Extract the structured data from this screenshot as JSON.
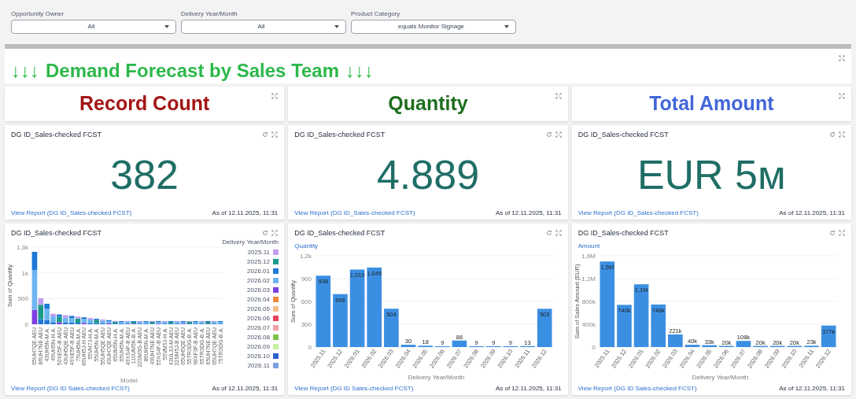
{
  "filters": [
    {
      "label": "Opportunity Owner",
      "value": "All"
    },
    {
      "label": "Delivery Year/Month",
      "value": "All"
    },
    {
      "label": "Product Category",
      "value": "equals Monitor Signage"
    }
  ],
  "banner": {
    "arrows_left": "↓↓↓",
    "title": "Demand Forecast by Sales Team",
    "arrows_right": "↓↓↓"
  },
  "headers": [
    {
      "title": "Record Count",
      "color": "#a31515"
    },
    {
      "title": "Quantity",
      "color": "#1f6e1f"
    },
    {
      "title": "Total Amount",
      "color": "#4266d9"
    }
  ],
  "metrics": [
    {
      "title": "DG ID_Sales-checked FCST",
      "value": "382",
      "link": "View Report (DG ID_Sales-checked FCST)",
      "as_of": "As of 12.11.2025, 11:31"
    },
    {
      "title": "DG ID_Sales-checked FCST",
      "value": "4.889",
      "link": "View Report (DG ID_Sales-checked FCST)",
      "as_of": "As of 12.11.2025, 11:31"
    },
    {
      "title": "DG ID_Sales-checked FCST",
      "value": "EUR 5м",
      "link": "View Report (DG ID_Sales-checked FCST)",
      "as_of": "As of 12.11.2025, 11:31"
    }
  ],
  "charts": [
    {
      "kind": "stacked",
      "title": "DG ID_Sales-checked FCST",
      "link": "View Report (DG ID  Sales-checked FCST)",
      "as_of": "As of 12.11.2025, 11:31",
      "ylabel": "Sum of Quantity",
      "xlabel": "Model",
      "yticks": [
        "1,3k",
        "1k",
        "500",
        "0"
      ],
      "legend_title": "Delivery Year/Month",
      "legend": [
        {
          "label": "2025.11",
          "color": "#c29cf0"
        },
        {
          "label": "2025.12",
          "color": "#1b9a8a"
        },
        {
          "label": "2026.01",
          "color": "#1f78d6"
        },
        {
          "label": "2026.02",
          "color": "#6db5f0"
        },
        {
          "label": "2026.03",
          "color": "#7b3fe0"
        },
        {
          "label": "2026.04",
          "color": "#f08a3c"
        },
        {
          "label": "2026.05",
          "color": "#f5c089"
        },
        {
          "label": "2026.06",
          "color": "#e8455a"
        },
        {
          "label": "2026.07",
          "color": "#f0a0a8"
        },
        {
          "label": "2026.08",
          "color": "#7cc24a"
        },
        {
          "label": "2026.09",
          "color": "#c8f0a0"
        },
        {
          "label": "2026.10",
          "color": "#2f5fd0"
        },
        {
          "label": "2026.11",
          "color": "#7f9fe0"
        }
      ],
      "models": [
        "65UH7QE AEU",
        "86UH7NE AEU",
        "43UH5N-M.A.",
        "49UH5N-H.A.",
        "50XE5F-B AEU",
        "43UH5QE AEU",
        "49XE5F-B AEU",
        "75UH5N-M.A.",
        "86UH5J-H AEU",
        "55VH7J-H.A.",
        "55UH5N-M.A.",
        "55UH5QE AEU",
        "43UH7QE AEU",
        "65UM5N-H.A.",
        "65UH5N-M.A.",
        "49XS4F-B AEU",
        "110UM5K-B.A.",
        "22SM3G-B AEU",
        "86UH5N-M.A.",
        "49UH7NE AEU",
        "55XS4F-B AEU",
        "55VM5J-H.A.",
        "43UL3J-M AEU",
        "32SM5J-B AEU",
        "65UH5QE AEU",
        "55TR3DG-B.A.",
        "98XF3F-B AEU",
        "65TR3DG-B.A.",
        "65UH7NE AEU",
        "65UH7QE AEU",
        "75TR3DG-B.A."
      ]
    },
    {
      "kind": "bar",
      "title": "DG ID_Sales-checked FCST",
      "link": "View Report (DG ID  Sales-checked FCST)",
      "as_of": "As of 12.11.2025, 11:31",
      "chart_data": {
        "type": "bar",
        "grid": true,
        "xlabel": "Delivery Year/Month",
        "ylabel": "Sum of Quantity",
        "categories": [
          "2025.11",
          "2025.12",
          "2026.01",
          "2026.02",
          "2026.03",
          "2026.04",
          "2026.05",
          "2026.06",
          "2026.07",
          "2026.08",
          "2026.09",
          "2026.10",
          "2026.11",
          "2026.12"
        ],
        "series": [
          {
            "name": "Quantity",
            "color": "#3b8fe3",
            "values": [
              938,
              696,
              1019,
              1045,
              504,
              30,
              18,
              9,
              86,
              9,
              9,
              9,
              13,
              503
            ]
          }
        ],
        "ylim": [
          0,
          1200
        ],
        "yticks": [
          0,
          300,
          600,
          900,
          {
            "value": 1200,
            "label": "1,2k"
          }
        ],
        "value_labels": [
          "938",
          "696",
          "1.019",
          "1.045",
          "504",
          "30",
          "18",
          "9",
          "86",
          "9",
          "9",
          "9",
          "13",
          "503"
        ]
      }
    },
    {
      "kind": "bar",
      "title": "DG ID_Sales-checked FCST",
      "link": "View Report (DG ID  Sales-checked FCST)",
      "as_of": "As of 12.11.2025, 11:31",
      "chart_data": {
        "type": "bar",
        "grid": true,
        "xlabel": "Delivery Year/Month",
        "ylabel": "Sum of Sales Amount (EUR)",
        "categories": [
          "2025.11",
          "2025.12",
          "2026.01",
          "2026.02",
          "2026.03",
          "2026.04",
          "2026.05",
          "2026.06",
          "2026.07",
          "2026.08",
          "2026.09",
          "2026.10",
          "2026.11",
          "2026.12"
        ],
        "series": [
          {
            "name": "Amount",
            "color": "#3b8fe3",
            "values": [
              1500000,
              740000,
              1100000,
              746000,
              221000,
              40000,
              33000,
              20000,
              108000,
              20000,
              20000,
              20000,
              23000,
              377000
            ]
          }
        ],
        "ylim": [
          0,
          1600000
        ],
        "yticks": [
          0,
          {
            "value": 400000,
            "label": "400k"
          },
          {
            "value": 800000,
            "label": "800k"
          },
          {
            "value": 1200000,
            "label": "1,2M"
          },
          {
            "value": 1600000,
            "label": "1,6M"
          }
        ],
        "value_labels": [
          "1,5M",
          "740k",
          "1,1M",
          "746k",
          "221k",
          "40k",
          "33k",
          "20k",
          "108k",
          "20k",
          "20k",
          "20k",
          "23k",
          "377k"
        ]
      }
    }
  ]
}
